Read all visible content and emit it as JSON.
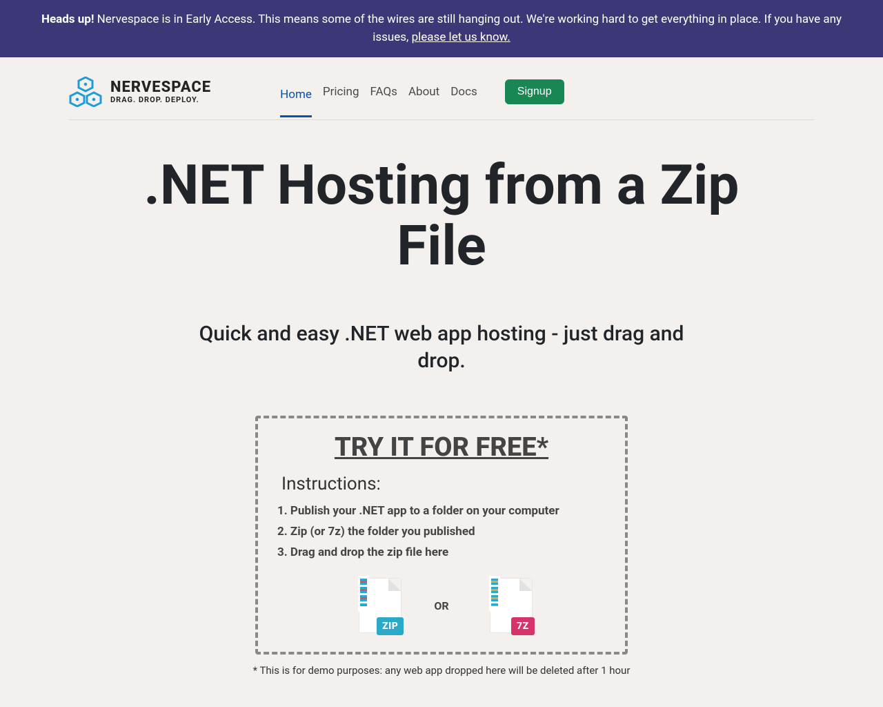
{
  "banner": {
    "strong": "Heads up!",
    "text1": " Nervespace is in Early Access. This means some of the wires are still hanging out. We're working hard to get everything in place. If you have any issues, ",
    "link": "please let us know."
  },
  "logo": {
    "name": "NERVESPACE",
    "tagline": "DRAG. DROP. DEPLOY."
  },
  "nav": {
    "home": "Home",
    "pricing": "Pricing",
    "faqs": "FAQs",
    "about": "About",
    "docs": "Docs",
    "signup": "Signup"
  },
  "hero": {
    "title": ".NET Hosting from a Zip File",
    "subtitle": "Quick and easy .NET web app hosting - just drag and drop."
  },
  "dropzone": {
    "title": "TRY IT FOR FREE*",
    "instructions_label": "Instructions:",
    "steps": [
      "1. Publish your .NET app to a folder on your computer",
      "2. Zip (or 7z) the folder you published",
      "3. Drag and drop the zip file here"
    ],
    "or": "OR",
    "ext_zip": "ZIP",
    "ext_7z": "7Z"
  },
  "disclaimer": "* This is for demo purposes: any web app dropped here will be deleted after 1 hour"
}
